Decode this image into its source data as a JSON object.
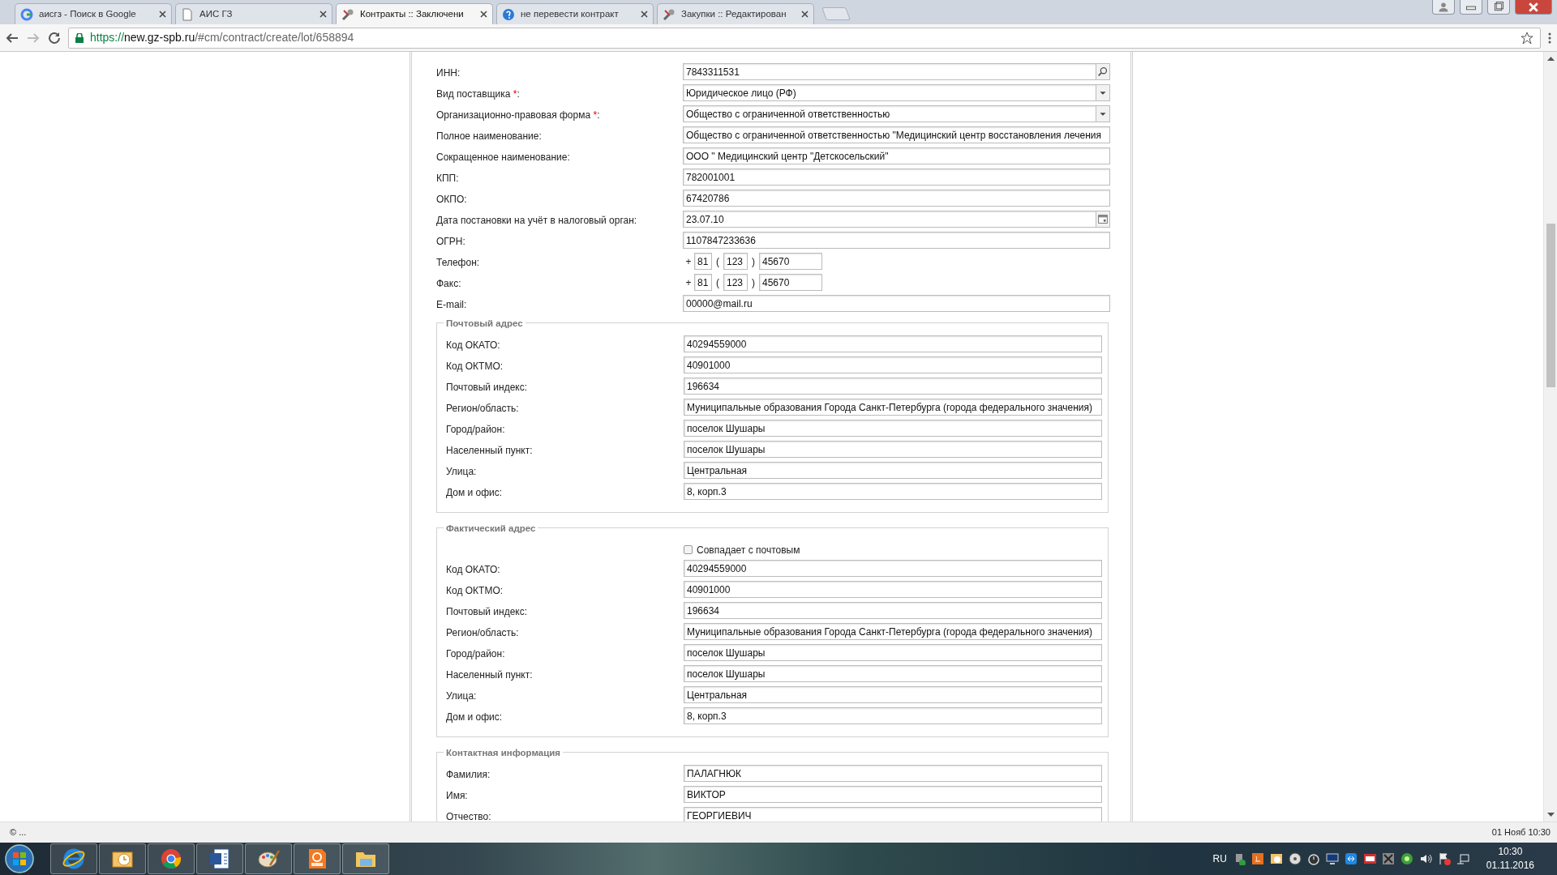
{
  "browser": {
    "tabs": [
      {
        "kind": "google",
        "title": "аисгз - Поиск в Google",
        "selected": false
      },
      {
        "kind": "page",
        "title": "АИС ГЗ",
        "selected": false
      },
      {
        "kind": "tool",
        "title": "Контракты :: Заключени",
        "selected": true
      },
      {
        "kind": "help",
        "title": "не перевести контракт",
        "selected": false
      },
      {
        "kind": "tool",
        "title": "Закупки :: Редактирован",
        "selected": false
      }
    ],
    "url_scheme": "https://",
    "url_host": "new.gz-spb.ru",
    "url_path": "/#cm/contract/create/lot/658894"
  },
  "form": {
    "fields": [
      {
        "kind": "search",
        "label": "ИНН:",
        "value": "7843311531"
      },
      {
        "kind": "select",
        "label": "Вид поставщика ",
        "required_mark": "*",
        "label_end": ":",
        "value": "Юридическое лицо (РФ)"
      },
      {
        "kind": "select",
        "label": "Организационно-правовая форма ",
        "required_mark": "*",
        "label_end": ":",
        "value": "Общество с ограниченной ответственностью"
      },
      {
        "kind": "text",
        "label": "Полное наименование:",
        "value": "Общество с ограниченной ответственностью \"Медицинский центр восстановления лечения"
      },
      {
        "kind": "text",
        "label": "Сокращенное наименование:",
        "value": "ООО \" Медицинский центр \"Детскосельский\""
      },
      {
        "kind": "text",
        "label": "КПП:",
        "value": "782001001"
      },
      {
        "kind": "text",
        "label": "ОКПО:",
        "value": "67420786"
      },
      {
        "kind": "date",
        "label": "Дата постановки на учёт в налоговый орган:",
        "value": "23.07.10"
      },
      {
        "kind": "text",
        "label": "ОГРН:",
        "value": "1107847233636"
      },
      {
        "kind": "phone",
        "label": "Телефон:",
        "plus": "+",
        "country": "81",
        "open": "(",
        "code": "123",
        "close": ")",
        "number": "45670"
      },
      {
        "kind": "phone",
        "label": "Факс:",
        "plus": "+",
        "country": "81",
        "open": "(",
        "code": "123",
        "close": ")",
        "number": "45670"
      },
      {
        "kind": "text",
        "label": "E-mail:",
        "value": "00000@mail.ru"
      }
    ],
    "sections": [
      {
        "legend": "Почтовый адрес",
        "fields": [
          {
            "label": "Код ОКАТО:",
            "value": "40294559000"
          },
          {
            "label": "Код ОКТМО:",
            "value": "40901000"
          },
          {
            "label": "Почтовый индекс:",
            "value": "196634"
          },
          {
            "label": "Регион/область:",
            "value": "Муниципальные образования Города Санкт-Петербурга (города федерального значения)"
          },
          {
            "label": "Город/район:",
            "value": "поселок Шушары"
          },
          {
            "label": "Населенный пункт:",
            "value": "поселок Шушары"
          },
          {
            "label": "Улица:",
            "value": "Центральная"
          },
          {
            "label": "Дом и офис:",
            "value": "8, корп.3"
          }
        ]
      },
      {
        "legend": "Фактический адрес",
        "checkbox": {
          "label": "Совпадает с почтовым",
          "checked": false
        },
        "fields": [
          {
            "label": "Код ОКАТО:",
            "value": "40294559000"
          },
          {
            "label": "Код ОКТМО:",
            "value": "40901000"
          },
          {
            "label": "Почтовый индекс:",
            "value": "196634"
          },
          {
            "label": "Регион/область:",
            "value": "Муниципальные образования Города Санкт-Петербурга (города федерального значения)"
          },
          {
            "label": "Город/район:",
            "value": "поселок Шушары"
          },
          {
            "label": "Населенный пункт:",
            "value": "поселок Шушары"
          },
          {
            "label": "Улица:",
            "value": "Центральная"
          },
          {
            "label": "Дом и офис:",
            "value": "8, корп.3"
          }
        ]
      },
      {
        "legend": "Контактная информация",
        "fields": [
          {
            "label": "Фамилия:",
            "value": "ПАЛАГНЮК"
          },
          {
            "label": "Имя:",
            "value": "ВИКТОР"
          },
          {
            "label": "Отчество:",
            "value": "ГЕОРГИЕВИЧ"
          }
        ]
      }
    ]
  },
  "status_bar": {
    "left": "© ...",
    "right": "01 Нояб 10:30"
  },
  "taskbar": {
    "language": "RU",
    "time": "10:30",
    "date": "01.11.2016"
  }
}
